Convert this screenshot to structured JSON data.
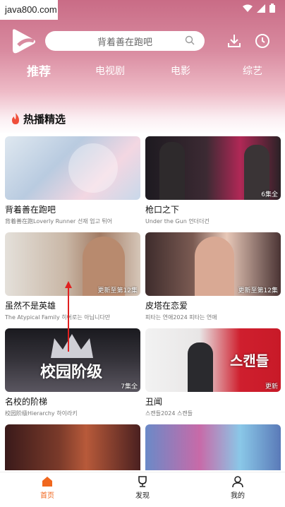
{
  "status": {
    "watermark": "java800.com"
  },
  "search": {
    "placeholder": "背着善在跑吧"
  },
  "tabs": [
    "推荐",
    "电视剧",
    "电影",
    "综艺"
  ],
  "section": {
    "title": "热播精选"
  },
  "cards": [
    {
      "title": "背着善在跑吧",
      "subtitle": "背着善在跑Loverly Runner 선재 업고 튀어",
      "badge": "",
      "thumb_text": ""
    },
    {
      "title": "枪口之下",
      "subtitle": "Under the Gun 언더더건",
      "badge": "6集全",
      "thumb_text": ""
    },
    {
      "title": "虽然不是英雄",
      "subtitle": "The Atypical Family 히어로는 아닙니다만",
      "badge": "更新至第12集",
      "thumb_text": ""
    },
    {
      "title": "皮塔在恋爱",
      "subtitle": "피타는 연애2024 피타는 연애",
      "badge": "更新至第12集",
      "thumb_text": ""
    },
    {
      "title": "名校的阶梯",
      "subtitle": "校园阶级Hierarchy 하이라키",
      "badge": "7集全",
      "thumb_text": "校园阶级"
    },
    {
      "title": "丑闻",
      "subtitle": "스캔들2024 스캔들",
      "badge": "更新",
      "thumb_text": "스캔들"
    },
    {
      "title": "",
      "subtitle": "",
      "badge": "",
      "thumb_text": ""
    },
    {
      "title": "",
      "subtitle": "",
      "badge": "",
      "thumb_text": ""
    }
  ],
  "tabbar": {
    "home": "首页",
    "discover": "发现",
    "mine": "我的"
  },
  "colors": {
    "accent": "#f0671e",
    "header": "#c96c86"
  }
}
